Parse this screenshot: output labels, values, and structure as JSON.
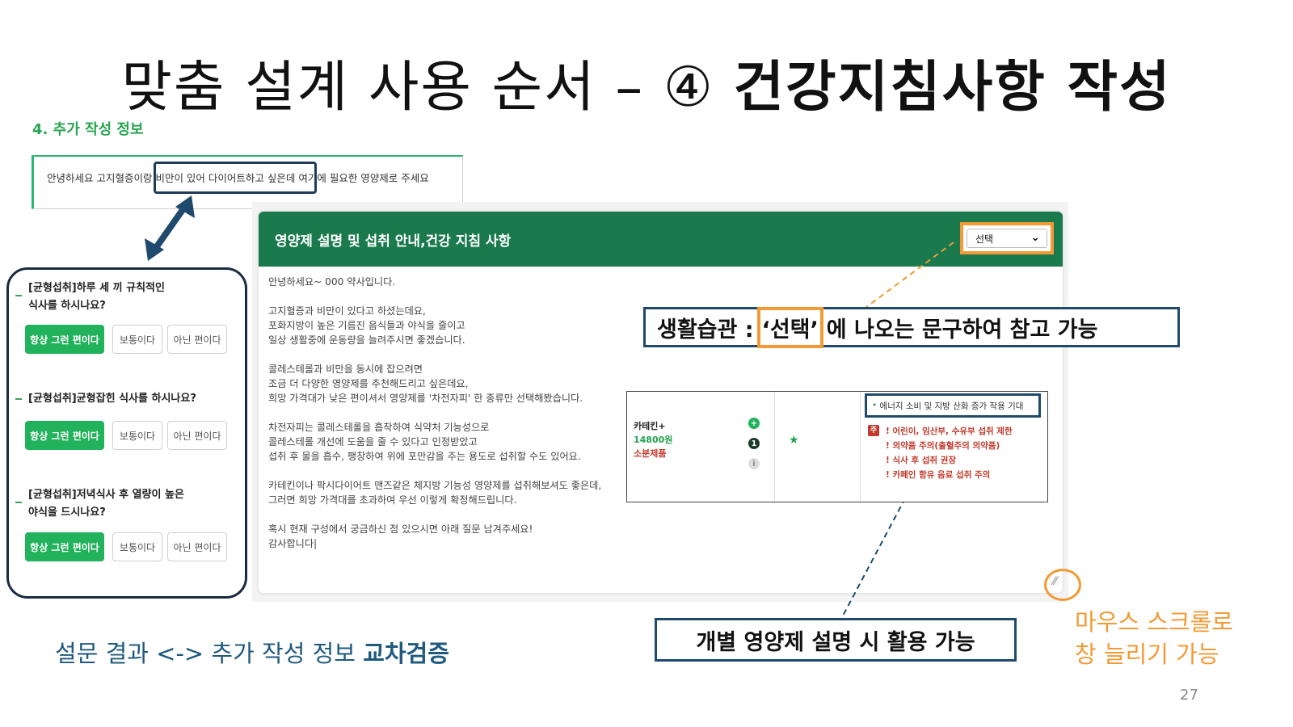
{
  "slide": {
    "title_plain": "맞춤 설계 사용 순서 – ④ ",
    "title_bold": "건강지침사항 작성",
    "page_number": "27"
  },
  "section": {
    "label": "4. 추가 작성 정보"
  },
  "request": {
    "text": "안녕하세요 고지혈증이랑 비만이 있어 다이어트하고 싶은데 여기에 필요한 영양제로 주세요",
    "highlighted": "비만이 있어 다이어트하고 싶은데"
  },
  "survey": {
    "questions": [
      {
        "line1": "[균형섭취]하루 세 끼 규칙적인",
        "line2": "식사를 하시나요?"
      },
      {
        "line1": "[균형섭취]균형잡힌 식사를 하시나요?",
        "line2": ""
      },
      {
        "line1": "[균형섭취]저녁식사 후 열량이 높은",
        "line2": "야식을 드시나요?"
      }
    ],
    "options": [
      "항상 그런 편이다",
      "보통이다",
      "아닌 편이다"
    ],
    "selected_option": "항상 그런 편이다"
  },
  "modal": {
    "title": "영양제 설명 및 섭취 안내,건강 지침 사항",
    "select_value": "선택",
    "letter": [
      [
        "안녕하세요~ 000 약사입니다."
      ],
      [
        "고지혈증과 비만이 있다고 하셨는데요,",
        "포화지방이 높은 기름진 음식들과 야식을 줄이고",
        "일상 생활중에 운동량을 늘려주시면 좋겠습니다."
      ],
      [
        "콜레스테롤과 비만을 동시에 잡으려면",
        "조금 더 다양한 영양제를 추천해드리고 싶은데요,",
        "희망 가격대가 낮은 편이셔서 영양제를 '차전자피' 한 종류만 선택해봤습니다."
      ],
      [
        "차전자피는 콜레스테롤을 흡착하여 식약처 기능성으로",
        "콜레스테롤 개선에 도움을 줄 수 있다고 인정받았고",
        "섭취 후 물을 흡수, 팽창하여 위에 포만감을 주는 용도로 섭취할 수도 있어요."
      ],
      [
        "카테킨이나 팍시다이어트 맨즈같은 체지방 기능성 영양제를 섭취해보셔도 좋은데,",
        "그러면 희망 가격대를 초과하여 우선 이렇게 확정해드립니다."
      ],
      [
        "혹시 현재 구성에서 궁금하신 점 있으시면 아래 질문 남겨주세요!",
        "감사합니다|"
      ]
    ]
  },
  "callouts": {
    "habit_prefix": "생활습관 : ",
    "habit_highlight": "‘선택’",
    "habit_suffix": "에 나오는 문구하여 참고 가능",
    "individual": "개별 영양제 설명 시 활용 가능",
    "resize_line1": "마우스 스크롤로",
    "resize_line2": "창 늘리기 가능"
  },
  "product": {
    "name": "카테킨+",
    "price": "14800원",
    "tag": "소분제품",
    "effect": "에너지 소비 및 지방 산화 증가 작용 기대",
    "warning_badge": "주",
    "warnings": [
      "! 어린이, 임산부, 수유부 섭취 제한",
      "! 의약품 주의(출혈주의 의약품)",
      "! 식사 후 섭취 권장",
      "! 카페인 함유 음료 섭취 주의"
    ],
    "dot_labels": [
      "+",
      "1",
      "i"
    ]
  },
  "bottom": {
    "caption_plain": "설문 결과 <-> 추가 작성 정보 ",
    "caption_bold": "교차검증"
  },
  "colors": {
    "header_green": "#1a7a4d",
    "button_green": "#21b25b",
    "accent_orange": "#f39a34",
    "callout_navy": "#1f4a6e",
    "warning_red": "#c0392b"
  }
}
